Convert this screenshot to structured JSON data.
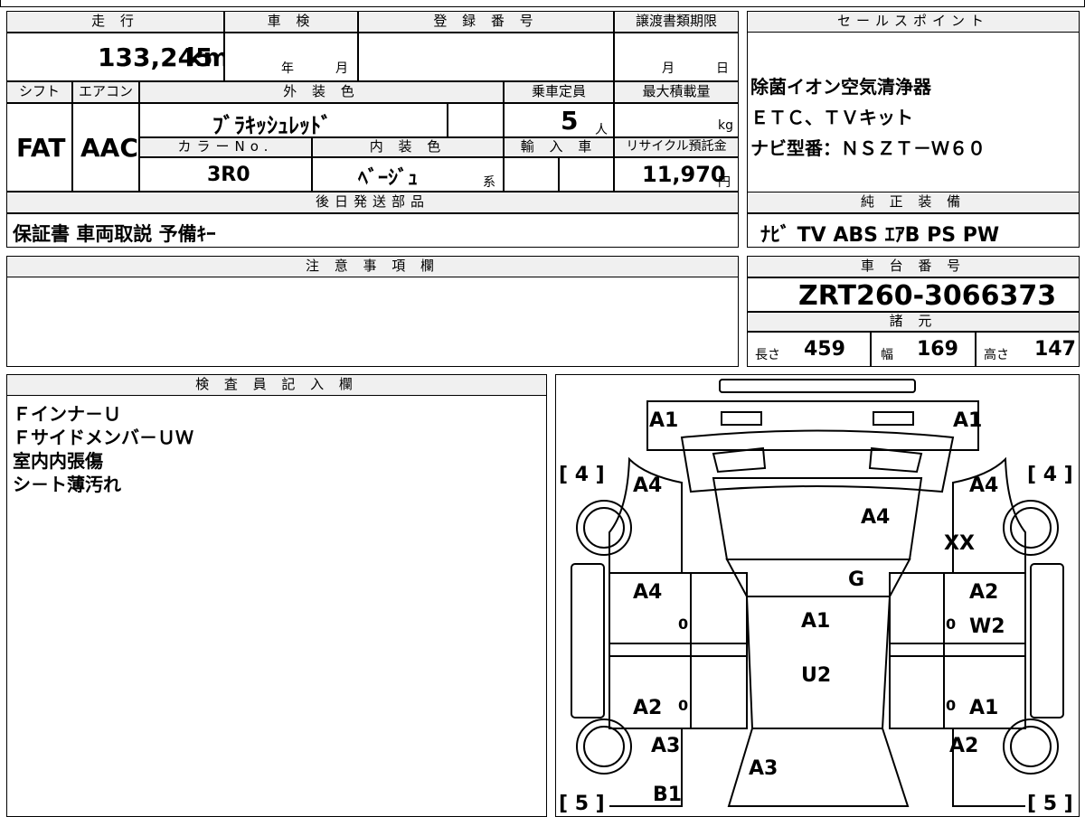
{
  "labels": {
    "mileage": "走 行",
    "inspection": "車 検",
    "registration": "登 録 番 号",
    "transfer_deadline": "譲渡書類期限",
    "sales_point": "セールスポイント",
    "shift": "シフト",
    "aircon": "エアコン",
    "exterior_color": "外 装 色",
    "capacity": "乗車定員",
    "max_load": "最大積載量",
    "color_no": "カラーNo.",
    "interior_color": "内 装 色",
    "import": "輸 入 車",
    "recycle_fee": "リサイクル預託金",
    "later_parts": "後日発送部品",
    "genuine_equipment": "純 正 装 備",
    "notes": "注 意 事 項 欄",
    "chassis_number": "車 台 番 号",
    "specs": "諸 元",
    "inspector_notes": "検 査 員 記 入 欄",
    "length": "長さ",
    "width": "幅",
    "height": "高さ",
    "year_unit": "年",
    "month_unit": "月",
    "day_unit": "日",
    "person_unit": "人",
    "kg_unit": "kg",
    "yen_unit": "円",
    "series_unit": "系"
  },
  "values": {
    "mileage": "133,245",
    "mileage_unit": "km",
    "shift": "FAT",
    "aircon": "AAC",
    "exterior_color": "ﾌﾞﾗｷｯｼｭﾚｯﾄﾞ",
    "capacity": "5",
    "color_no": "3R0",
    "interior_color": "ﾍﾞｰｼﾞｭ",
    "recycle_fee": "11,970",
    "later_parts": "保証書 車両取説 予備ｷｰ",
    "genuine_equipment": "ﾅﾋﾞ TV ABS ｴｱB PS PW",
    "chassis_number": "ZRT260-3066373",
    "length": "459",
    "width": "169",
    "height": "147"
  },
  "sales_points": [
    "除菌イオン空気清浄器",
    "ＥＴＣ、ＴＶキット",
    "ナビ型番：ＮＳＺＴ－Ｗ６０"
  ],
  "inspector_lines": [
    "Ｆインナ－Ｕ",
    "Ｆサイドメンバ－ＵＷ",
    "室内内張傷",
    "シ－ト薄汚れ"
  ],
  "diagram": {
    "tire_tl": "[ 4 ]",
    "tire_tr": "[ 4 ]",
    "tire_bl": "[ 5 ]",
    "tire_br": "[ 5 ]",
    "marks": {
      "a1_left": "A1",
      "a1_right": "A1",
      "a4_fl": "A4",
      "a4_fr": "A4",
      "a4_hood": "A4",
      "xx": "XX",
      "g_windshield": "G",
      "a4_fdoor_l": "A4",
      "a2_fdoor_r": "A2",
      "a1_roof": "A1",
      "w2_fdoor_r": "W2",
      "u2_roof": "U2",
      "a2_rdoor_l": "A2",
      "a1_rdoor_r": "A1",
      "a3_rear_l": "A3",
      "a2_rear_r": "A2",
      "a3_trunk": "A3",
      "b1_rear": "B1",
      "zero1": "0",
      "zero2": "0",
      "zero3": "0",
      "zero4": "0"
    }
  }
}
